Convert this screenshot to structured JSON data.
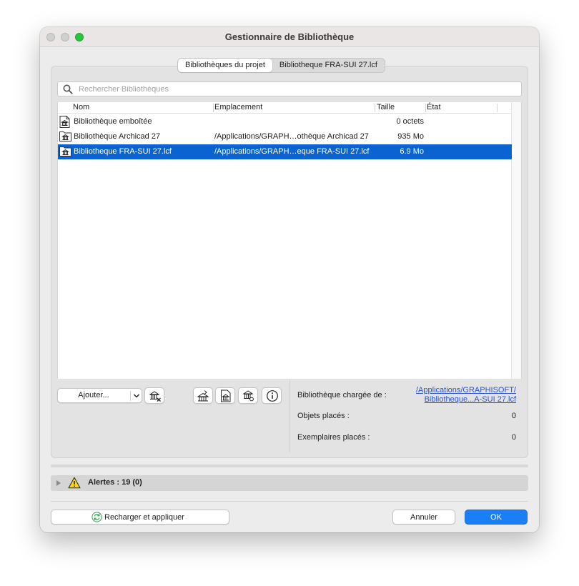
{
  "window": {
    "title": "Gestionnaire de Bibliothèque"
  },
  "tabs": [
    {
      "label": "Bibliothèques du projet",
      "active": true
    },
    {
      "label": "Bibliotheque FRA-SUI 27.lcf",
      "active": false
    }
  ],
  "search": {
    "placeholder": "Rechercher Bibliothèques",
    "value": ""
  },
  "table": {
    "columns": {
      "name": "Nom",
      "location": "Emplacement",
      "size": "Taille",
      "status": "État"
    },
    "rows": [
      {
        "icon": "library-file-icon",
        "name": "Bibliothèque emboîtée",
        "location": "",
        "size": "0 octets",
        "status": ""
      },
      {
        "icon": "library-folder-icon",
        "name": "Bibliothèque Archicad 27",
        "location": "/Applications/GRAPH…othèque Archicad 27",
        "size": "935 Mo",
        "status": ""
      },
      {
        "icon": "library-folder-icon",
        "name": "Bibliotheque FRA-SUI 27.lcf",
        "location": "/Applications/GRAPH…eque FRA-SUI 27.lcf",
        "size": "6.9 Mo",
        "status": "",
        "selected": true
      }
    ]
  },
  "toolbar": {
    "add_label": "Ajouter...",
    "icons": [
      "remove-library-icon",
      "move-up-library-icon",
      "library-document-icon",
      "library-settings-icon",
      "info-icon"
    ]
  },
  "info": {
    "loaded_label": "Bibliothèque chargée de :",
    "loaded_path_line1": "/Applications/GRAPHISOFT/",
    "loaded_path_line2": "Bibliotheque...A-SUI 27.lcf",
    "placed_objects_label": "Objets placés :",
    "placed_objects_value": "0",
    "placed_instances_label": "Exemplaires placés :",
    "placed_instances_value": "0"
  },
  "alerts": {
    "label": "Alertes : 19 (0)"
  },
  "footer": {
    "reload_label": "Recharger et appliquer",
    "cancel_label": "Annuler",
    "ok_label": "OK"
  },
  "colors": {
    "selection": "#0a63d0",
    "accent": "#1a7ef5",
    "link": "#2a52cc"
  }
}
